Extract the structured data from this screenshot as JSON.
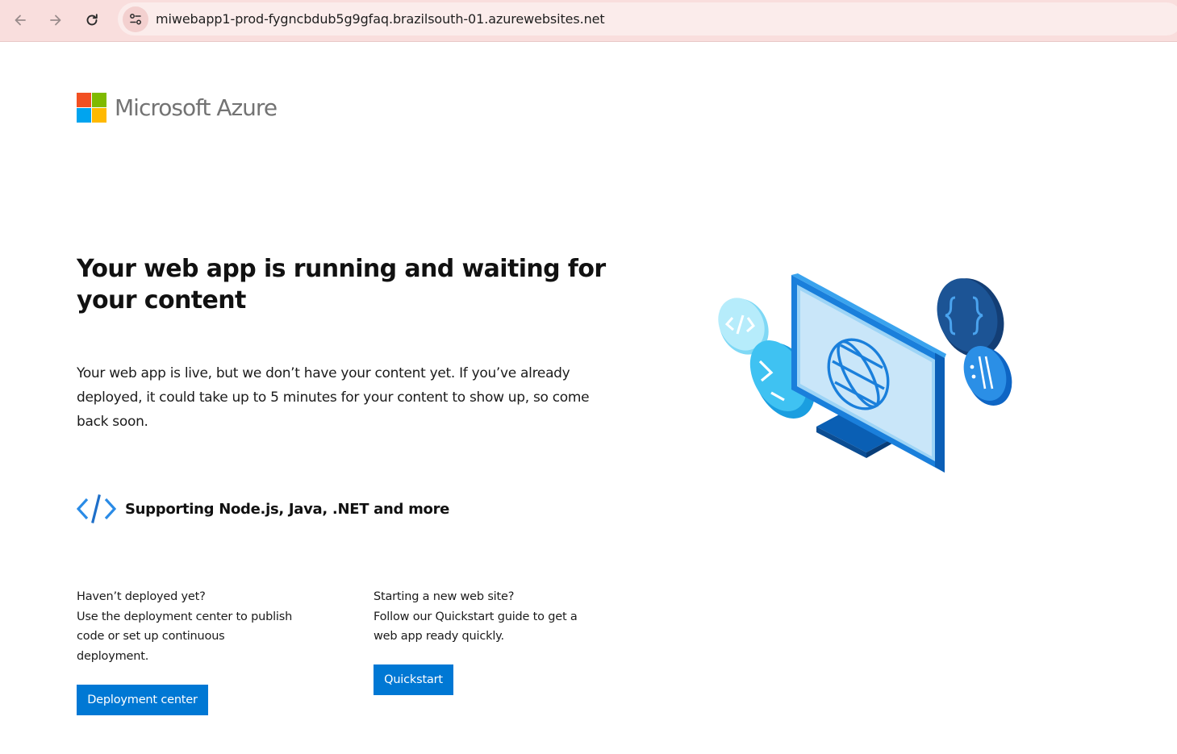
{
  "browser": {
    "url": "miwebapp1-prod-fygncbdub5g9gfaq.brazilsouth-01.azurewebsites.net",
    "back_icon": "arrow-left-icon",
    "forward_icon": "arrow-right-icon",
    "reload_icon": "reload-icon",
    "site_info_icon": "tune-icon"
  },
  "brand": {
    "name": "Microsoft Azure",
    "logo_colors": [
      "#f25022",
      "#7fba00",
      "#00a4ef",
      "#ffb900"
    ]
  },
  "hero": {
    "title": "Your web app is running and waiting for your content",
    "description": "Your web app is live, but we don’t have your content yet. If you’ve already deployed, it could take up to 5 minutes for your content to show up, so come back soon.",
    "support_text": "Supporting Node.js, Java, .NET and more"
  },
  "deploy": {
    "line1": "Haven’t deployed yet?",
    "line2": "Use the deployment center to publish code or set up continuous deployment.",
    "button": "Deployment center"
  },
  "quickstart": {
    "line1": "Starting a new web site?",
    "line2": "Follow our Quickstart guide to get a web app ready quickly.",
    "button": "Quickstart"
  },
  "colors": {
    "accent": "#0078d4",
    "chrome_bg": "#f9dedd"
  }
}
